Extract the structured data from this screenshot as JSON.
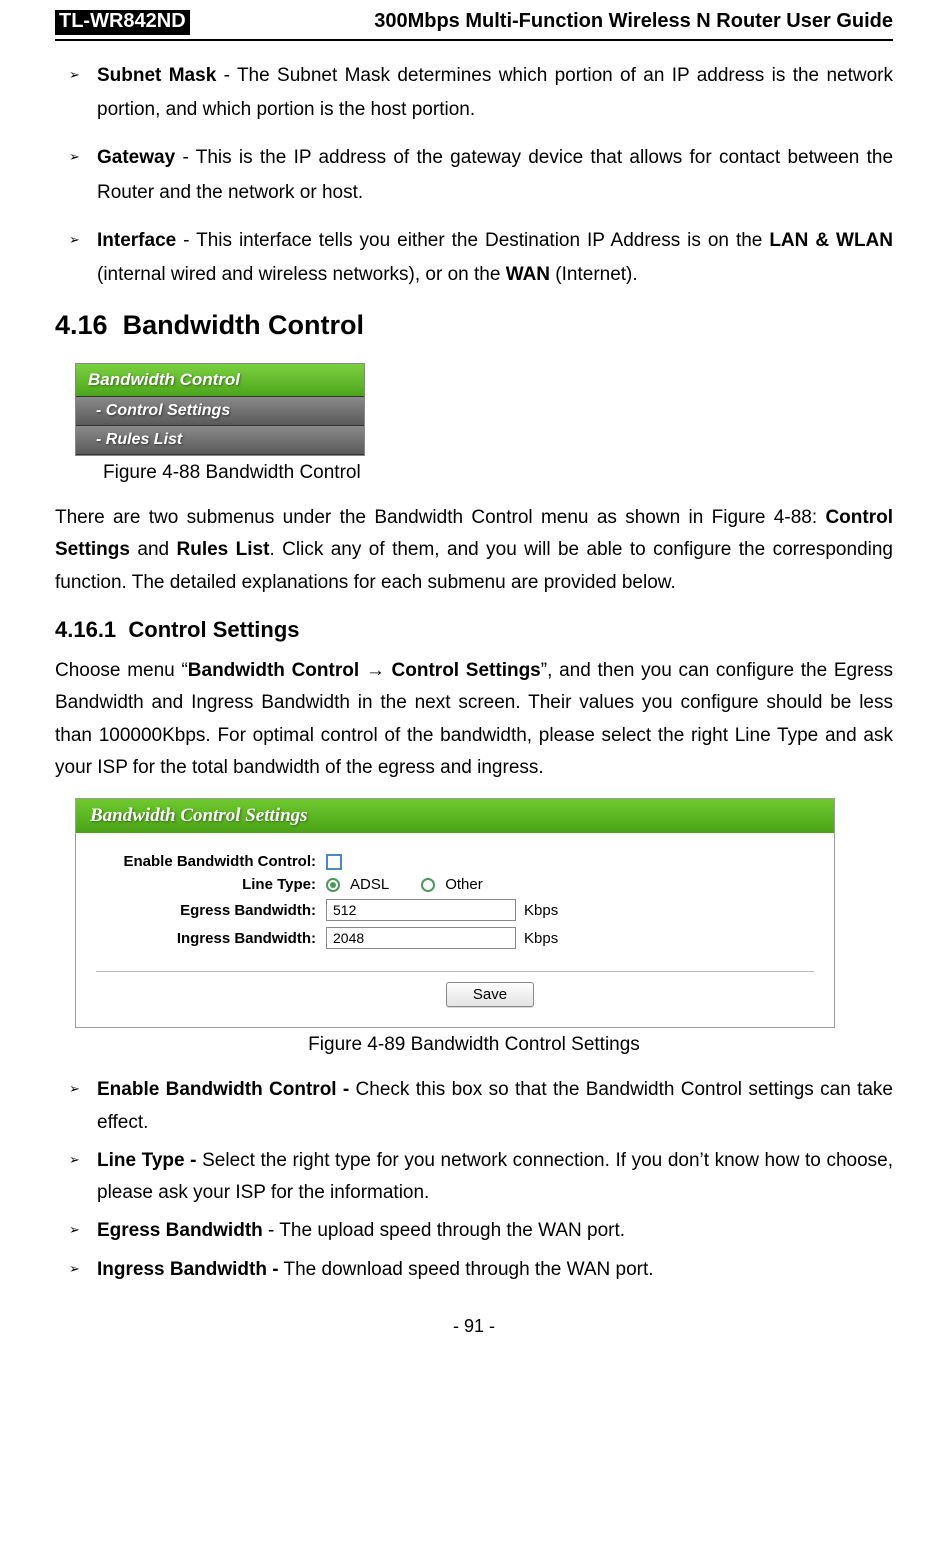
{
  "header": {
    "model": "TL-WR842ND",
    "title": "300Mbps Multi-Function Wireless N Router User Guide"
  },
  "top_bullets": [
    {
      "term": "Subnet Mask",
      "sep": " - ",
      "text": "The Subnet Mask determines which portion of an IP address is the network portion, and which portion is the host portion."
    },
    {
      "term": "Gateway",
      "sep": " - ",
      "text": "This is the IP address of the gateway device that allows for contact between the Router and the network or host."
    },
    {
      "term": "Interface",
      "sep": " - ",
      "text_pre": "This interface tells you either the Destination IP Address is on the ",
      "bold1": "LAN & WLAN",
      "text_mid": " (internal wired and wireless networks), or on the ",
      "bold2": "WAN",
      "text_post": " (Internet)."
    }
  ],
  "section": {
    "num": "4.16",
    "title": "Bandwidth Control"
  },
  "menu": {
    "header": "Bandwidth Control",
    "items": [
      "- Control Settings",
      "- Rules List"
    ]
  },
  "fig88": "Figure 4-88 Bandwidth Control",
  "para1": {
    "pre": "There are two submenus under the Bandwidth Control menu as shown in Figure 4-88: ",
    "b1": "Control Settings",
    "mid1": " and ",
    "b2": "Rules List",
    "post": ". Click any of them, and you will be able to configure the corresponding function. The detailed explanations for each submenu are provided below."
  },
  "subsection": {
    "num": "4.16.1",
    "title": "Control Settings"
  },
  "para2": {
    "pre": "Choose menu “",
    "b1": "Bandwidth Control → Control Settings",
    "post": "”, and then you can configure the Egress Bandwidth and Ingress Bandwidth in the next screen. Their values you configure should be less than 100000Kbps. For optimal control of the bandwidth, please select the right Line Type and ask your ISP for the total bandwidth of the egress and ingress."
  },
  "settings": {
    "title": "Bandwidth Control Settings",
    "rows": {
      "enable_label": "Enable Bandwidth Control:",
      "line_type_label": "Line Type:",
      "adsl": "ADSL",
      "other": "Other",
      "egress_label": "Egress Bandwidth:",
      "egress_value": "512",
      "ingress_label": "Ingress Bandwidth:",
      "ingress_value": "2048",
      "unit": "Kbps"
    },
    "save": "Save"
  },
  "fig89": "Figure 4-89 Bandwidth Control Settings",
  "bottom_bullets": [
    {
      "term": "Enable Bandwidth Control -",
      "text": " Check this box so that the Bandwidth Control settings can take effect."
    },
    {
      "term": "Line Type -",
      "text": " Select the right type for you network connection. If you don’t know how to choose, please ask your ISP for the information."
    },
    {
      "term": "Egress Bandwidth",
      "sep": " - ",
      "text": "The upload speed through the WAN port."
    },
    {
      "term": "Ingress Bandwidth -",
      "text": " The download speed through the WAN port."
    }
  ],
  "page_num": "- 91 -"
}
